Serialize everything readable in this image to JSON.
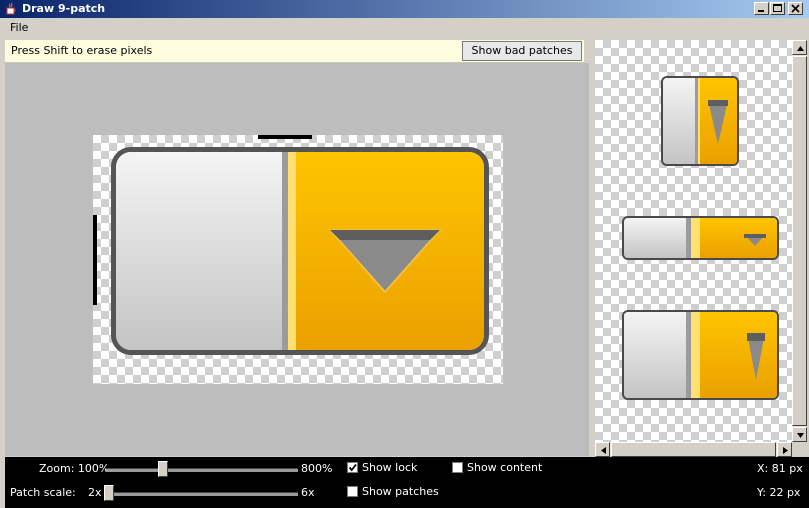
{
  "window": {
    "title": "Draw 9-patch"
  },
  "menu": {
    "items": [
      "File"
    ]
  },
  "status": {
    "hint": "Press Shift to erase pixels",
    "bad_patches_label": "Show bad patches"
  },
  "colors": {
    "accent_orange": "#f5b000",
    "button_grey": "#d6d6d6",
    "patch_marker": "#000000",
    "control_bar": "#000000",
    "status_background": "#fffde0"
  },
  "controls": {
    "zoom": {
      "label": "Zoom: 100%",
      "max_label": "800%",
      "value_fraction": 0.29
    },
    "patch_scale": {
      "label": "Patch scale:",
      "min_label": "2x",
      "max_label": "6x",
      "value_fraction": 0.0
    },
    "show_lock": {
      "label": "Show lock",
      "checked": true
    },
    "show_patches": {
      "label": "Show patches",
      "checked": false
    },
    "show_content": {
      "label": "Show content",
      "checked": false
    },
    "x_readout": "X: 81 px",
    "y_readout": "Y: 22 px"
  }
}
